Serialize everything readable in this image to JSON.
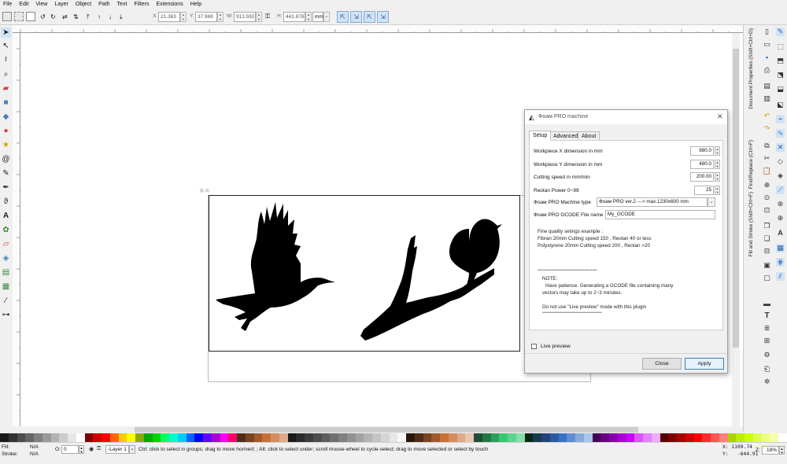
{
  "menu": [
    "File",
    "Edit",
    "View",
    "Layer",
    "Object",
    "Path",
    "Text",
    "Filters",
    "Extensions",
    "Help"
  ],
  "toolbar": {
    "x_label": "X:",
    "x_value": "21.363",
    "y_label": "Y:",
    "y_value": "37.968",
    "w_label": "W:",
    "w_value": "913.592",
    "h_label": "H:",
    "h_value": "441.878",
    "unit": "mm"
  },
  "canvas": {
    "page_corner_label": "(0, 0)"
  },
  "right_panels": {
    "doc_props": "Document Properties (Shift+Ctrl+D)",
    "find_replace": "Find/Replace (Ctrl+F)",
    "fill_stroke": "Fill and Stroke (Shift+Ctrl+F)"
  },
  "dialog": {
    "title": "Фоам PRO machine",
    "tabs": [
      "Setup",
      "Advanced",
      "About"
    ],
    "fields": {
      "workpiece_x": {
        "label": "Workpiece X dimension in mm",
        "value": "980.0"
      },
      "workpiece_y": {
        "label": "Workpiece Y dimension in mm",
        "value": "480.0"
      },
      "cutting_speed": {
        "label": "Cutting speed in mm/min",
        "value": "200.00"
      },
      "reotan_power": {
        "label": "Reotan Power 0~99",
        "value": "25"
      },
      "machine_type": {
        "label": "Фоам PRO Machine type",
        "value": "Фоам PRO ver.2 ---> max.1230x600 mm"
      },
      "gcode_name": {
        "label": "Фоам PRO GCODE File name",
        "value": "My_GCODE"
      }
    },
    "info": {
      "line1": "Fine quality setings example :",
      "line2": "Fibran 20mm Cutting speed 150 , Reotan  40 or less",
      "line3": "Polystyrene 20mm Cutting speed 200 , Reotan >20",
      "sep1": "************************************************************",
      "note": "NOTE:",
      "note2": "Have patience. Generating a GCODE file containing many",
      "note3": "vectors may take up to 2~3 minutes.",
      "note4": "Do not use \"Live preview\" mode with this plugin",
      "sep2": "************************************************************"
    },
    "live_preview": "Live preview",
    "close": "Close",
    "apply": "Apply"
  },
  "status": {
    "fill_label": "Fill:",
    "fill_value": "N/A",
    "stroke_label": "Stroke:",
    "stroke_value": "N/A",
    "opacity_label": "O:",
    "opacity_value": "0",
    "layer": "-Layer 1",
    "message": "Ctrl: click to select in groups; drag to move hor/vert; ; Alt: click to select under; scroll mouse-wheel to cycle-select; drag to move selected or select by touch",
    "x_coord": "X: 1109.74",
    "y_coord": "Y:   -644.91",
    "zoom_label": "Z:",
    "zoom": "18%"
  },
  "palette": [
    "#1a1a1a",
    "#333",
    "#4d4d4d",
    "#666",
    "#808080",
    "#999",
    "#b3b3b3",
    "#ccc",
    "#e6e6e6",
    "#fff",
    "#800000",
    "#d40000",
    "#ff0000",
    "#ff6600",
    "#ffcc00",
    "#ffff00",
    "#88aa00",
    "#00aa00",
    "#00d400",
    "#00ff66",
    "#00ffcc",
    "#00ccff",
    "#0066ff",
    "#0000ff",
    "#6600ff",
    "#aa00d4",
    "#ff00ff",
    "#ff0066",
    "#502d16",
    "#784421",
    "#a05a2c",
    "#c87137",
    "#d38d5f",
    "#deaa87",
    "#1a1a1a",
    "#2b2b2b",
    "#3c3c3c",
    "#4d4d4d",
    "#5e5e5e",
    "#6f6f6f",
    "#808080",
    "#919191",
    "#a2a2a2",
    "#b3b3b3",
    "#c4c4c4",
    "#d5d5d5",
    "#e6e6e6",
    "#f7f7f7",
    "#28170b",
    "#502d16",
    "#784421",
    "#a05a2c",
    "#c87137",
    "#d38d5f",
    "#deaa87",
    "#e9c6af",
    "#1f4d3a",
    "#217844",
    "#2ca05a",
    "#37c871",
    "#5fd38d",
    "#87deaa",
    "#0b2817",
    "#163c50",
    "#214478",
    "#2c5aa0",
    "#3771c8",
    "#5f8dd3",
    "#87aade",
    "#aac6ec",
    "#440055",
    "#660080",
    "#8800aa",
    "#aa00d4",
    "#cc00ff",
    "#dd55ff",
    "#e580ff",
    "#eeaaff",
    "#550000",
    "#800000",
    "#aa0000",
    "#d40000",
    "#ff0000",
    "#ff2a2a",
    "#ff5555",
    "#ff8080",
    "#aad400",
    "#bbee00",
    "#ccff00",
    "#ddff55",
    "#eeff80",
    "#f6ffaa",
    "#ffffff"
  ]
}
